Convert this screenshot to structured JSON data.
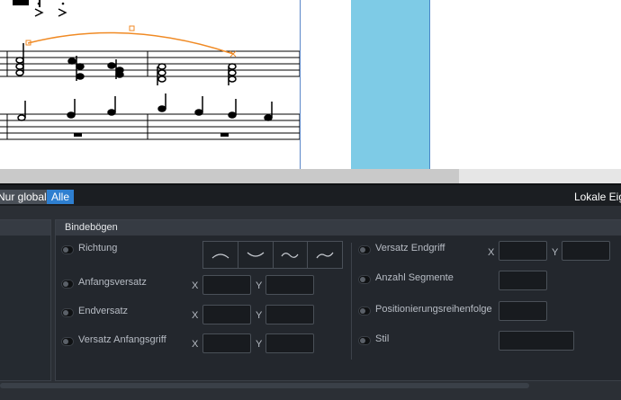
{
  "filter_bar": {
    "global_label": "Nur global",
    "all_label": "Alle",
    "local_label": "Lokale Eig"
  },
  "section": {
    "title": "Bindebögen",
    "left_rows": [
      {
        "label": "Richtung"
      },
      {
        "label": "Anfangsversatz",
        "x_label": "X",
        "y_label": "Y"
      },
      {
        "label": "Endversatz",
        "x_label": "X",
        "y_label": "Y"
      },
      {
        "label": "Versatz Anfangsgriff",
        "x_label": "X",
        "y_label": "Y"
      }
    ],
    "right_rows": [
      {
        "label": "Versatz Endgriff",
        "x_label": "X",
        "y_label": "Y"
      },
      {
        "label": "Anzahl Segmente"
      },
      {
        "label": "Positionierungsreihenfolge"
      },
      {
        "label": "Stil"
      }
    ],
    "direction_options": [
      "arc-up-icon",
      "arc-down-icon",
      "s-curve-icon",
      "s-curve-reverse-icon"
    ]
  },
  "colors": {
    "slur": "#f08a24",
    "accent": "#2e7fd0",
    "gap_bar": "#7ecbe6"
  }
}
